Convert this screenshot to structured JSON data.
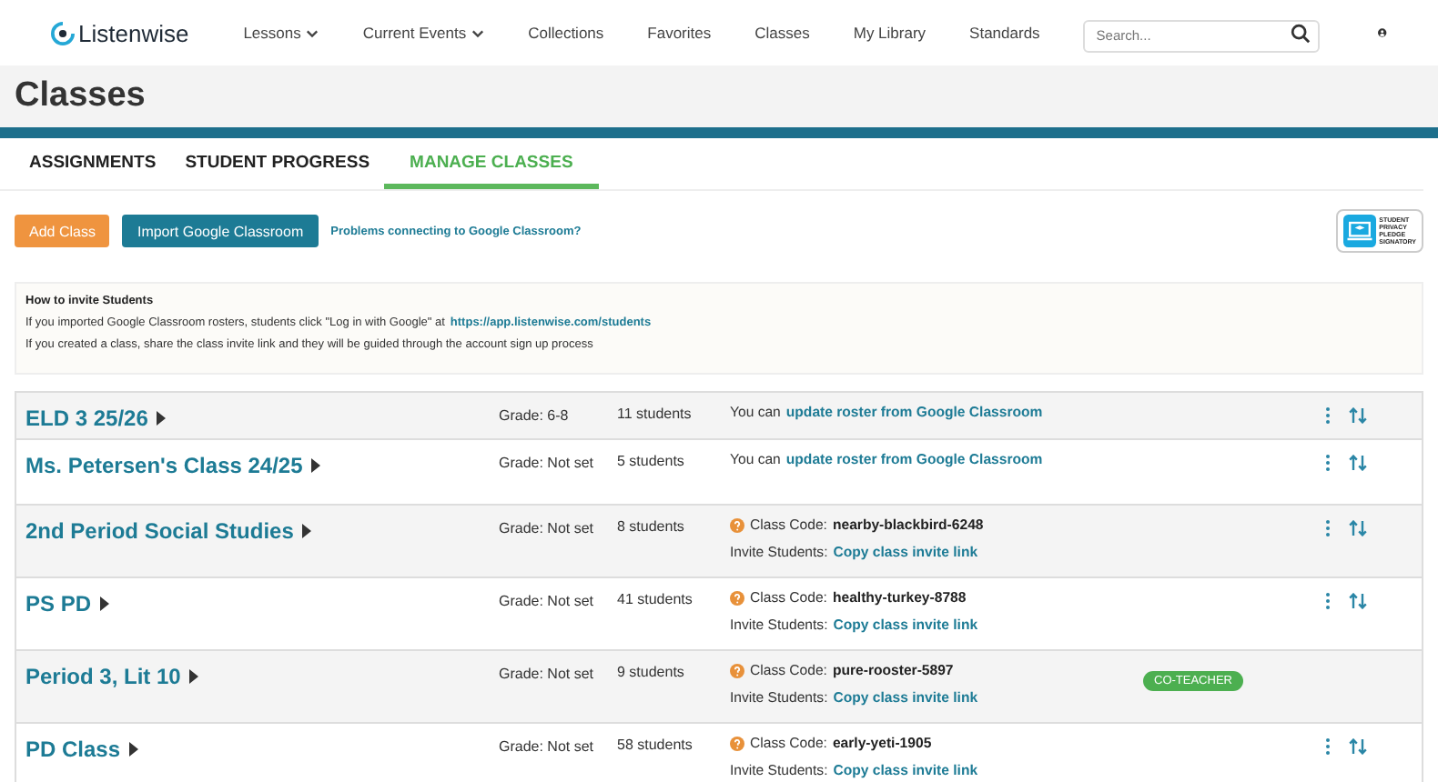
{
  "header": {
    "logo": "Listenwise",
    "nav": [
      {
        "label": "Lessons",
        "dropdown": true
      },
      {
        "label": "Current Events",
        "dropdown": true
      },
      {
        "label": "Collections",
        "dropdown": false
      },
      {
        "label": "Favorites",
        "dropdown": false
      },
      {
        "label": "Classes",
        "dropdown": false
      },
      {
        "label": "My Library",
        "dropdown": false
      },
      {
        "label": "Standards",
        "dropdown": false
      }
    ],
    "search": {
      "placeholder": "Search..."
    }
  },
  "page_title": "Classes",
  "tabs": [
    {
      "label": "ASSIGNMENTS",
      "selected": false
    },
    {
      "label": "STUDENT PROGRESS",
      "selected": false
    },
    {
      "label": "MANAGE CLASSES",
      "selected": true
    }
  ],
  "actions": {
    "add_button": "Add Class",
    "import_button": "Import Google Classroom",
    "help_link": "Problems connecting to Google Classroom?",
    "badge_lines": [
      "STUDENT",
      "PRIVACY",
      "PLEDGE",
      "SIGNATORY"
    ]
  },
  "info": {
    "title": "How to invite Students",
    "line_1": "If you imported Google Classroom rosters, students click \"Log in with Google\" at",
    "line_1_link": "https://app.listenwise.com/students",
    "line_2": "If you created a class, share the class invite link and they will be guided through the account sign up process"
  },
  "classes": [
    {
      "name": "ELD 3 25/26",
      "grade": "Grade: 6-8",
      "students": "11 students",
      "kind": "google",
      "prefix": "You can",
      "link": "update roster from Google Classroom",
      "co_teacher": false
    },
    {
      "name": "Ms. Petersen's Class 24/25",
      "grade": "Grade: Not set",
      "students": "5 students",
      "kind": "google",
      "prefix": "You can",
      "link": "update roster from Google Classroom",
      "co_teacher": false
    },
    {
      "name": "2nd Period Social Studies",
      "grade": "Grade: Not set",
      "students": "8 students",
      "kind": "code",
      "code_label": "Class Code:",
      "code": "nearby-blackbird-6248",
      "invite_label": "Invite Students:",
      "link": "Copy class invite link",
      "co_teacher": false
    },
    {
      "name": "PS PD",
      "grade": "Grade: Not set",
      "students": "41 students",
      "kind": "code",
      "code_label": "Class Code:",
      "code": "healthy-turkey-8788",
      "invite_label": "Invite Students:",
      "link": "Copy class invite link",
      "co_teacher": false
    },
    {
      "name": "Period 3, Lit 10",
      "grade": "Grade: Not set",
      "students": "9 students",
      "kind": "code",
      "code_label": "Class Code:",
      "code": "pure-rooster-5897",
      "invite_label": "Invite Students:",
      "link": "Copy class invite link",
      "co_teacher": true,
      "badge": "CO-TEACHER"
    },
    {
      "name": "PD Class",
      "grade": "Grade: Not set",
      "students": "58 students",
      "kind": "code",
      "code_label": "Class Code:",
      "code": "early-yeti-1905",
      "invite_label": "Invite Students:",
      "link": "Copy class invite link",
      "co_teacher": false
    }
  ]
}
